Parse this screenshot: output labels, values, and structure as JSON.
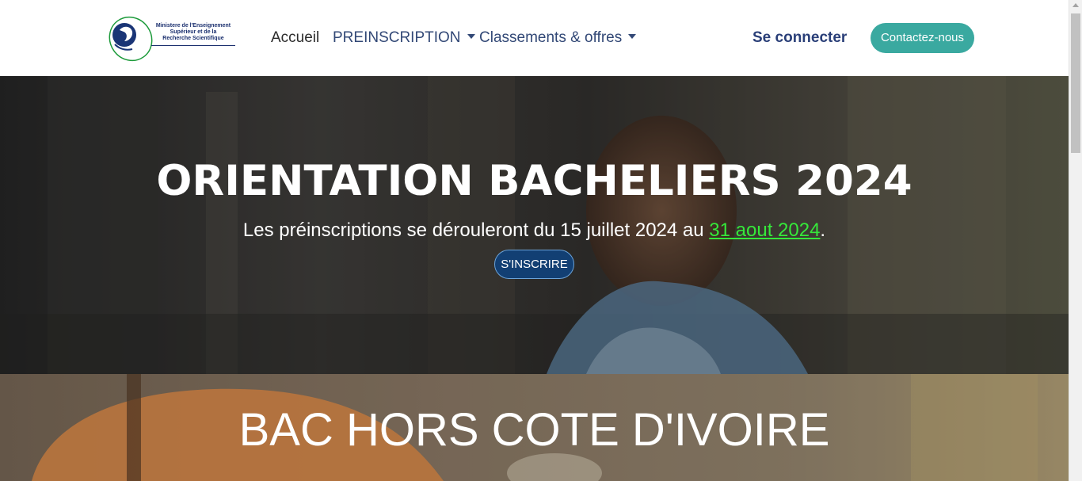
{
  "header": {
    "logo": {
      "text_lines": "Ministere de l'Enseignement\nSupérieur et de la\nRecherche Scientifique"
    },
    "nav": {
      "home": "Accueil",
      "preinscription": "PREINSCRIPTION",
      "classements": "Classements & offres"
    },
    "login": "Se connecter",
    "contact": "Contactez-nous"
  },
  "hero": {
    "title": "ORIENTATION BACHELIERS 2024",
    "subtitle_before": "Les préinscriptions se dérouleront du 15 juillet 2024 au ",
    "subtitle_link": "31 aout 2024",
    "subtitle_after": ".",
    "cta": "S'INSCRIRE"
  },
  "hero2": {
    "title": "BAC HORS COTE D'IVOIRE"
  },
  "icons": {
    "nav_dropdown": "caret-down-icon",
    "scroll_up": "arrow-up-icon"
  },
  "colors": {
    "nav_text": "#324876",
    "contact_button": "#3aa9a0",
    "signup_button": "#123f73",
    "date_link": "#35e83a"
  }
}
